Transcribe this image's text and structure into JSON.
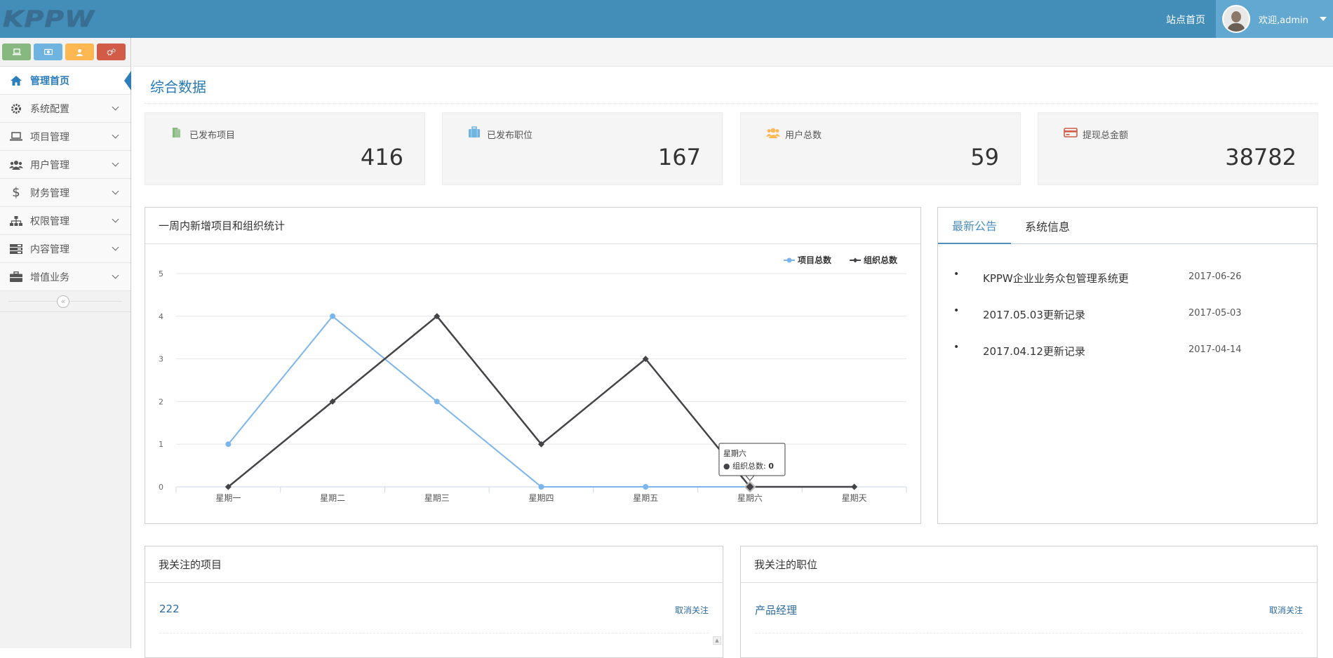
{
  "header": {
    "logo_text": "KPPW",
    "site_home": "站点首页",
    "welcome": "欢迎,admin"
  },
  "sidebar": {
    "menu": [
      {
        "label": "管理首页",
        "icon": "home-icon"
      },
      {
        "label": "系统配置",
        "icon": "gear-icon"
      },
      {
        "label": "项目管理",
        "icon": "laptop-icon"
      },
      {
        "label": "用户管理",
        "icon": "users-icon"
      },
      {
        "label": "财务管理",
        "icon": "dollar-icon"
      },
      {
        "label": "权限管理",
        "icon": "sitemap-icon"
      },
      {
        "label": "内容管理",
        "icon": "list-icon"
      },
      {
        "label": "增值业务",
        "icon": "briefcase-icon"
      }
    ]
  },
  "page": {
    "title": "综合数据"
  },
  "stats": [
    {
      "label": "已发布项目",
      "value": "416",
      "icon_color": "#87b87f"
    },
    {
      "label": "已发布职位",
      "value": "167",
      "icon_color": "#6fb3e0"
    },
    {
      "label": "用户总数",
      "value": "59",
      "icon_color": "#ffb752"
    },
    {
      "label": "提现总金额",
      "value": "38782",
      "icon_color": "#d15b47"
    }
  ],
  "chart_panel": {
    "title": "一周内新增项目和组织统计"
  },
  "chart_data": {
    "type": "line",
    "categories": [
      "星期一",
      "星期二",
      "星期三",
      "星期四",
      "星期五",
      "星期六",
      "星期天"
    ],
    "series": [
      {
        "name": "项目总数",
        "values": [
          1,
          4,
          2,
          0,
          0,
          0,
          null
        ],
        "color": "#7cb5ec"
      },
      {
        "name": "组织总数",
        "values": [
          0,
          2,
          4,
          1,
          3,
          0,
          0
        ],
        "color": "#434348"
      }
    ],
    "yticks": [
      0,
      1,
      2,
      3,
      4,
      5
    ],
    "ylim": [
      0,
      5
    ],
    "legend": "top-right",
    "grid": true,
    "tooltip": {
      "title": "星期六",
      "series": "组织总数:",
      "value": "0"
    }
  },
  "notice_panel": {
    "tabs": [
      "最新公告",
      "系统信息"
    ],
    "items": [
      {
        "title": "KPPW企业业务众包管理系统更",
        "date": "2017-06-26"
      },
      {
        "title": "2017.05.03更新记录",
        "date": "2017-05-03"
      },
      {
        "title": "2017.04.12更新记录",
        "date": "2017-04-14"
      }
    ]
  },
  "watch_projects": {
    "title": "我关注的项目",
    "item": "222",
    "action": "取消关注"
  },
  "watch_jobs": {
    "title": "我关注的职位",
    "item": "产品经理",
    "action": "取消关注"
  }
}
